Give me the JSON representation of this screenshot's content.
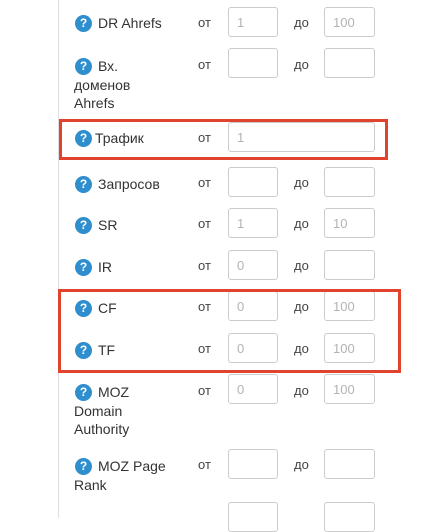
{
  "colors": {
    "help_icon": "#2f8fce",
    "highlight": "#e0432e",
    "border": "#cccccc"
  },
  "help_icon_glyph": "?",
  "labels": {
    "from": "от",
    "to": "до"
  },
  "filters": [
    {
      "id": "dr-ahrefs",
      "label_lines": [
        "DR Ahrefs"
      ],
      "from_placeholder": "1",
      "to_placeholder": "100"
    },
    {
      "id": "vh-domenov-ahrefs",
      "label_lines": [
        "Вх.",
        "доменов",
        "Ahrefs"
      ],
      "from_placeholder": "",
      "to_placeholder": ""
    },
    {
      "id": "trafik",
      "label_lines": [
        "Трафик"
      ],
      "from_placeholder": "1"
    },
    {
      "id": "zaprosov",
      "label_lines": [
        "Запросов"
      ],
      "from_placeholder": "",
      "to_placeholder": ""
    },
    {
      "id": "sr",
      "label_lines": [
        "SR"
      ],
      "from_placeholder": "1",
      "to_placeholder": "10"
    },
    {
      "id": "ir",
      "label_lines": [
        "IR"
      ],
      "from_placeholder": "0",
      "to_placeholder": ""
    },
    {
      "id": "cf",
      "label_lines": [
        "CF"
      ],
      "from_placeholder": "0",
      "to_placeholder": "100"
    },
    {
      "id": "tf",
      "label_lines": [
        "TF"
      ],
      "from_placeholder": "0",
      "to_placeholder": "100"
    },
    {
      "id": "moz-domain-authority",
      "label_lines": [
        "MOZ",
        "Domain",
        "Authority"
      ],
      "from_placeholder": "0",
      "to_placeholder": "100"
    },
    {
      "id": "moz-page-rank",
      "label_lines": [
        "MOZ Page",
        "Rank"
      ],
      "from_placeholder": "",
      "to_placeholder": ""
    }
  ]
}
